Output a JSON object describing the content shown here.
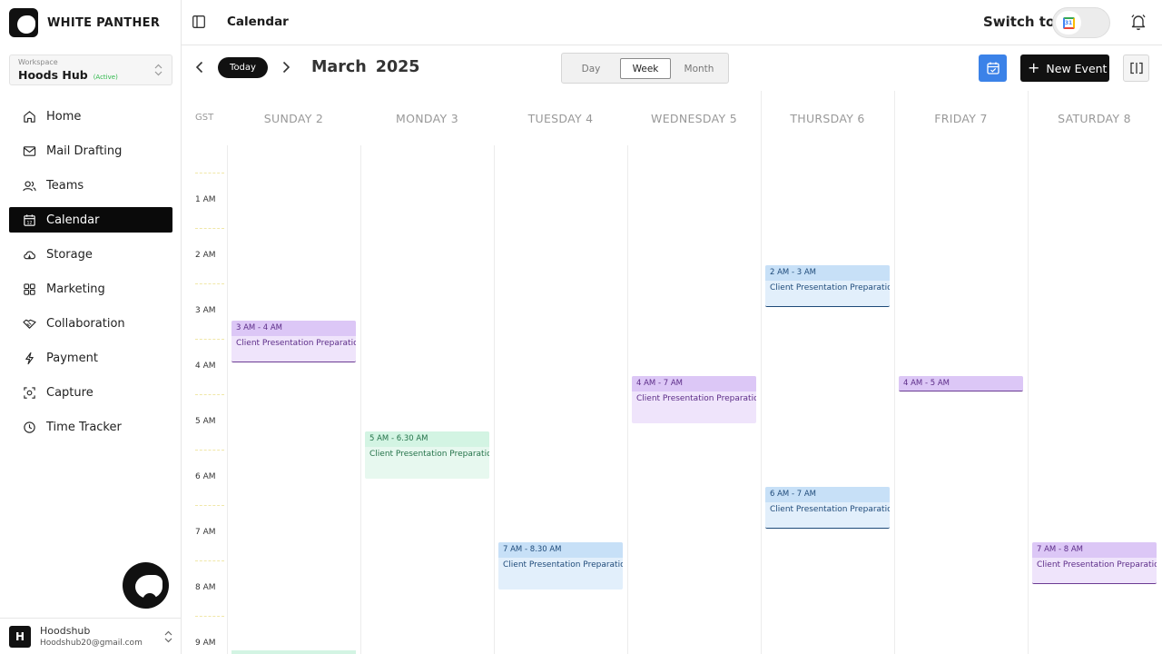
{
  "brand": {
    "name": "WHITE PANTHER"
  },
  "workspace": {
    "label": "Workspace",
    "name": "Hoods Hub",
    "status": "(Active)"
  },
  "nav": [
    {
      "label": "Home",
      "icon": "home-icon"
    },
    {
      "label": "Mail Drafting",
      "icon": "mail-icon"
    },
    {
      "label": "Teams",
      "icon": "users-icon"
    },
    {
      "label": "Calendar",
      "icon": "calendar-icon",
      "active": true
    },
    {
      "label": "Storage",
      "icon": "cloud-icon"
    },
    {
      "label": "Marketing",
      "icon": "grid-icon"
    },
    {
      "label": "Collaboration",
      "icon": "handshake-icon"
    },
    {
      "label": "Payment",
      "icon": "bolt-icon"
    },
    {
      "label": "Capture",
      "icon": "capture-icon"
    },
    {
      "label": "Time Tracker",
      "icon": "clock-icon"
    }
  ],
  "account": {
    "initial": "H",
    "name": "Hoodshub",
    "email": "Hoodshub20@gmail.com"
  },
  "header": {
    "title": "Calendar",
    "switch_label": "Switch to",
    "switch_icon": "google-calendar-icon"
  },
  "toolbar": {
    "today_label": "Today",
    "month": "March",
    "year": "2025",
    "views": [
      "Day",
      "Week",
      "Month"
    ],
    "active_view": "Week",
    "new_event_label": "New Event"
  },
  "calendar": {
    "timezone": "GST",
    "days": [
      "SUNDAY 2",
      "MONDAY 3",
      "TUESDAY 4",
      "WEDNESDAY 5",
      "THURSDAY 6",
      "FRIDAY 7",
      "SATURDAY 8"
    ],
    "hours": [
      "1 AM",
      "2 AM",
      "3 AM",
      "4 AM",
      "5 AM",
      "6 AM",
      "7 AM",
      "8 AM",
      "9 AM"
    ],
    "events": [
      {
        "day": 0,
        "time": "3 AM - 4 AM",
        "title": "Client Presentation Preparation",
        "color": "purple"
      },
      {
        "day": 1,
        "time": "5 AM - 6.30 AM",
        "title": "Client Presentation Preparation",
        "color": "green"
      },
      {
        "day": 2,
        "time": "7 AM - 8.30 AM",
        "title": "Client Presentation Preparation",
        "color": "blue-soft"
      },
      {
        "day": 3,
        "time": "4 AM - 7 AM",
        "title": "Client Presentation Preparation",
        "color": "purple-soft"
      },
      {
        "day": 4,
        "time": "2 AM - 3 AM",
        "title": "Client Presentation Preparation",
        "color": "blue"
      },
      {
        "day": 4,
        "time": "6 AM - 7 AM",
        "title": "Client Presentation Preparation",
        "color": "blue"
      },
      {
        "day": 5,
        "time": "4 AM - 5 AM",
        "title": "",
        "color": "purple"
      },
      {
        "day": 6,
        "time": "7 AM - 8 AM",
        "title": "Client Presentation Preparation",
        "color": "purple"
      }
    ]
  },
  "colors": {
    "accent": "#3b82e8",
    "active_nav": "#0a0a0a"
  }
}
